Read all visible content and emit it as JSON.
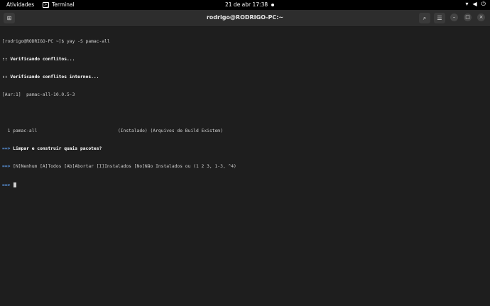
{
  "topbar": {
    "activities": "Atividades",
    "app_name": "Terminal",
    "clock": "21 de abr  17:38",
    "status_icons": {
      "network": "▾",
      "volume": "◀",
      "power": "⏻"
    }
  },
  "window": {
    "title": "rodrigo@RODRIGO-PC:~"
  },
  "terminal": {
    "lines": [
      {
        "text": "[rodrigo@RODRIGO-PC ~]$ yay -S pamac-all",
        "style": "plain"
      },
      {
        "text": ":: Verificando conflitos...",
        "style": "bold"
      },
      {
        "text": ":: Verificando conflitos internos...",
        "style": "bold"
      },
      {
        "text": "[Aur:1]  pamac-all-10.0.5-3",
        "style": "plain"
      },
      {
        "text": "",
        "style": "plain"
      },
      {
        "text": "  1 pamac-all                              (Instalado) (Arquivos de Build Existem)",
        "style": "plain"
      },
      {
        "prefix": "==> ",
        "text": "Limpar e construir quais pacotes?",
        "style": "prompt"
      },
      {
        "prefix": "==> ",
        "text": "[N]Nenhum [A]Todos [Ab]Abortar [I]Instalados [No]Não Instalados ou (1 2 3, 1-3, ^4)",
        "style": "prompt"
      },
      {
        "prefix": "==> ",
        "text": "",
        "style": "input"
      }
    ]
  }
}
